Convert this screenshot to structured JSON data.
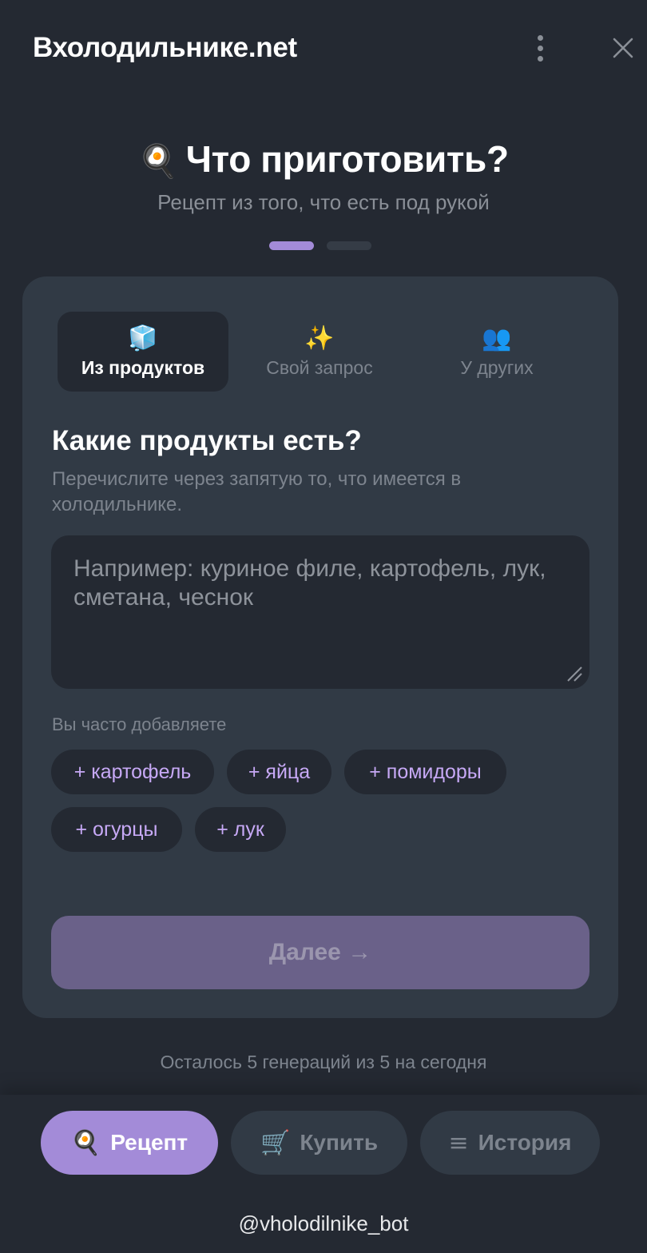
{
  "header": {
    "title": "Вхолодильнике.net",
    "menu_icon": "more-vertical-icon",
    "close_icon": "close-icon"
  },
  "hero": {
    "emoji": "🍳",
    "title": "Что приготовить?",
    "subtitle": "Рецепт из того, что есть под рукой",
    "step_current": 1,
    "step_total": 2
  },
  "tabs": [
    {
      "icon": "🧊",
      "icon_name": "ice-cube-icon",
      "label": "Из продуктов",
      "active": true
    },
    {
      "icon": "✨",
      "icon_name": "sparkles-icon",
      "label": "Свой запрос",
      "active": false
    },
    {
      "icon": "👥",
      "icon_name": "people-icon",
      "label": "У других",
      "active": false
    }
  ],
  "form": {
    "title": "Какие продукты есть?",
    "description": "Перечислите через запятую то, что имеется в холодильнике.",
    "placeholder": "Например: куриное филе, картофель, лук, сметана, чеснок",
    "value": "",
    "often_label": "Вы часто добавляете",
    "chips": [
      "+ картофель",
      "+ яйца",
      "+ помидоры",
      "+ огурцы",
      "+ лук"
    ],
    "next_label": "Далее →"
  },
  "remaining": "Осталось 5 генераций из 5 на сегодня",
  "bottom_nav": [
    {
      "icon": "🍳",
      "label": "Рецепт",
      "active": true
    },
    {
      "icon": "🛒",
      "label": "Купить",
      "active": false
    },
    {
      "icon": "≡",
      "label": "История",
      "active": false
    }
  ],
  "bot_handle": "@vholodilnike_bot",
  "colors": {
    "background": "#242932",
    "card": "#313a45",
    "accent": "#a38bd8",
    "chip_text": "#c7a9f6",
    "muted_text": "#7d848e",
    "disabled_button": "#6a6189"
  }
}
